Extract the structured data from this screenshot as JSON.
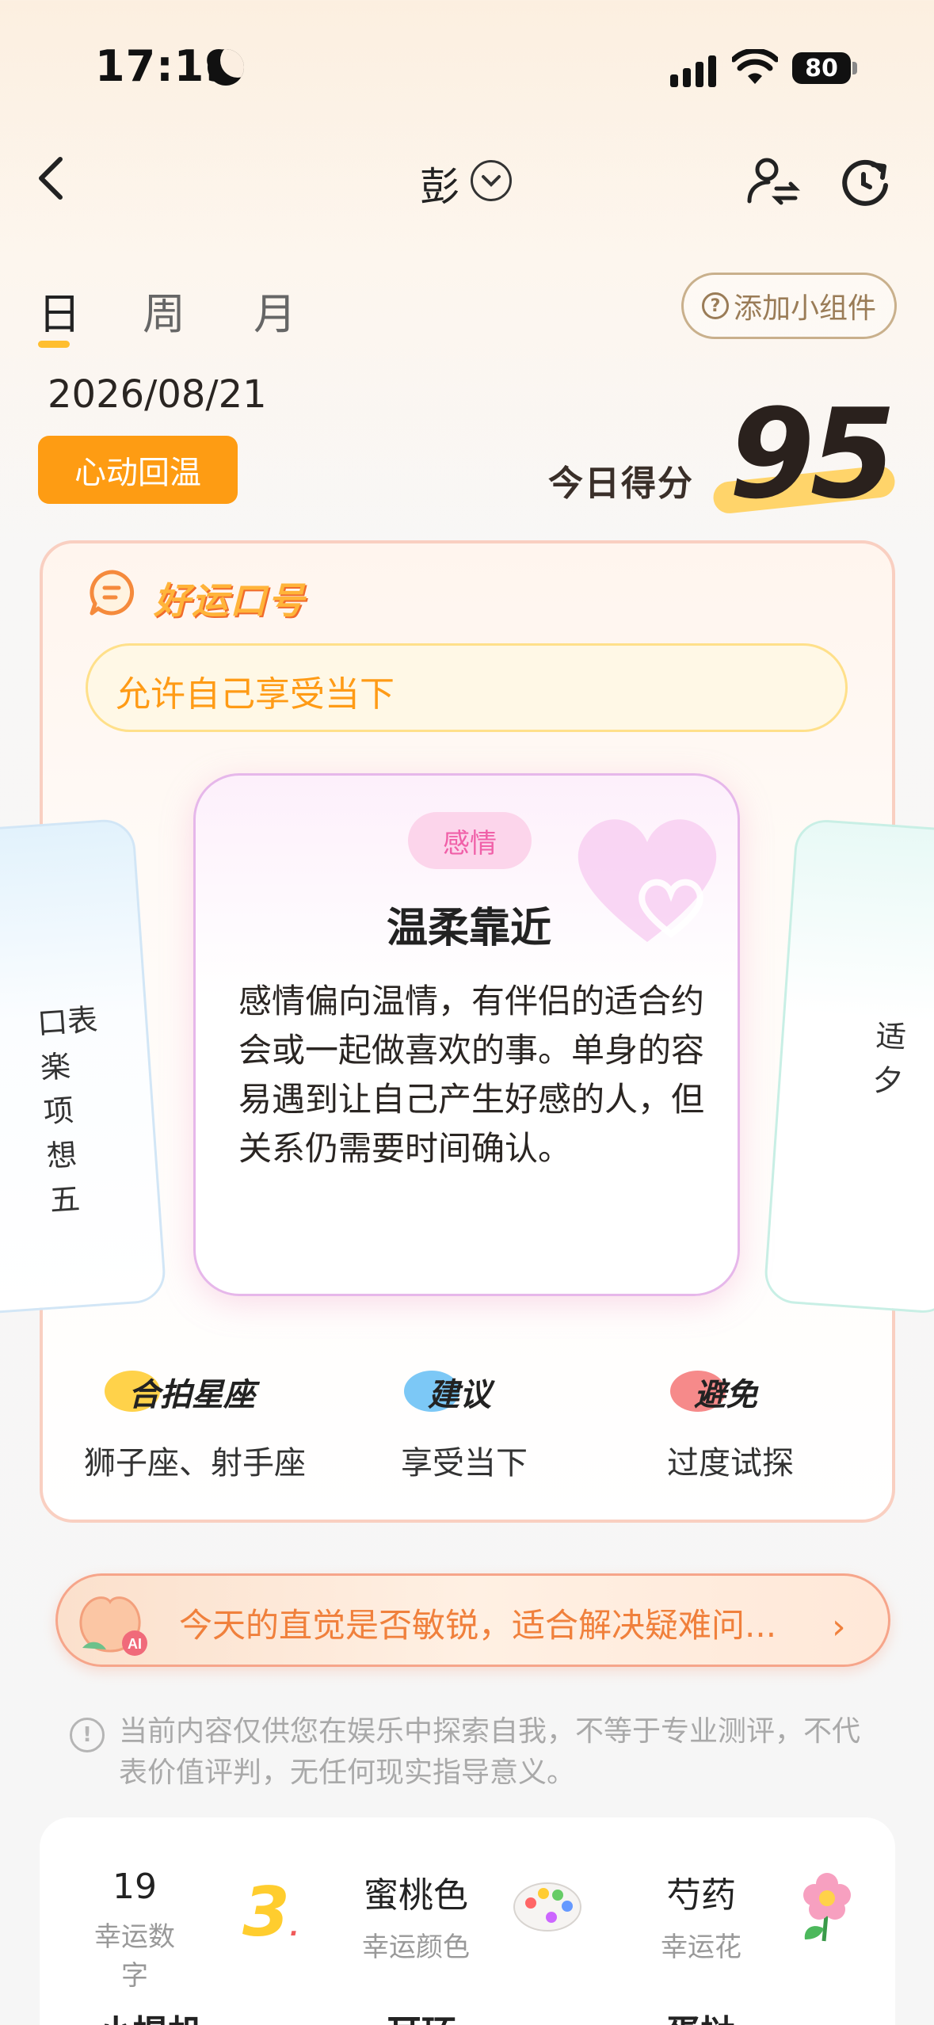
{
  "status_bar": {
    "time": "17:19",
    "battery": "80"
  },
  "header": {
    "name": "彭"
  },
  "tabs": [
    {
      "label": "日"
    },
    {
      "label": "周"
    },
    {
      "label": "月"
    }
  ],
  "widget_button": {
    "label": "添加小组件"
  },
  "date": "2026/08/21",
  "mood_badge": "心动回温",
  "score": {
    "label": "今日得分",
    "value": "95"
  },
  "slogan": {
    "title": "好运口号",
    "text": "允许自己享受当下"
  },
  "card": {
    "category": "感情",
    "title": "温柔靠近",
    "body": "感情偏向温情，有伴侣的适合约会或一起做喜欢的事。单身的容易遇到让自己产生好感的人，但关系仍需要时间确认。"
  },
  "side_left_text": [
    "口表",
    "楽",
    "项",
    "想",
    "五"
  ],
  "side_right_text": [
    "适",
    "夕"
  ],
  "info": [
    {
      "label": "合拍星座",
      "value": "狮子座、射手座",
      "color": "#ffd24a"
    },
    {
      "label": "建议",
      "value": "享受当下",
      "color": "#7cc8f6"
    },
    {
      "label": "避免",
      "value": "过度试探",
      "color": "#f68a8a"
    }
  ],
  "ai_bar": {
    "text": "今天的直觉是否敏锐，适合解决疑难问..."
  },
  "disclaimer": "当前内容仅供您在娱乐中探索自我，不等于专业测评，不代表价值评判，无任何现实指导意义。",
  "lucky": [
    {
      "value": "19",
      "label": "幸运数字",
      "icon": "number-3-icon"
    },
    {
      "value": "蜜桃色",
      "label": "幸运颜色",
      "icon": "palette-icon"
    },
    {
      "value": "芍药",
      "label": "幸运花",
      "icon": "flower-icon"
    }
  ],
  "lucky_row2": [
    "小提机",
    "耳环",
    "蛋挞"
  ]
}
